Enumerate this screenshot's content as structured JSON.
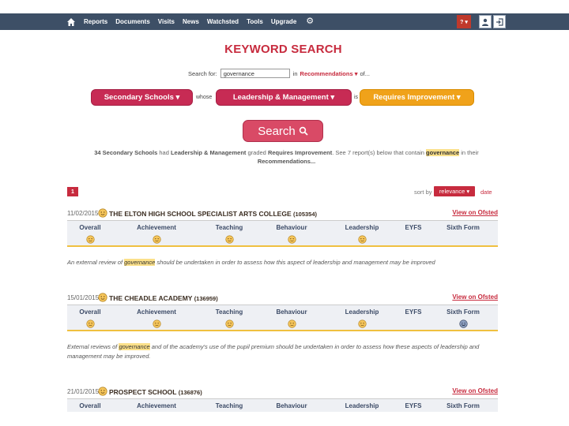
{
  "nav": {
    "items": [
      "Reports",
      "Documents",
      "Visits",
      "News",
      "Watchsted",
      "Tools",
      "Upgrade"
    ],
    "help_label": "? ▾"
  },
  "search": {
    "title": "KEYWORD SEARCH",
    "search_for_label": "Search for:",
    "keyword_value": "governance",
    "in_label": "in",
    "section_label": "Recommendations",
    "section_caret": "▾",
    "of_label": "of...",
    "school_type": "Secondary Schools ▾",
    "whose_label": "whose",
    "judgement": "Leadership & Management ▾",
    "is_label": "is",
    "grade": "Requires Improvement ▾",
    "button_label": "Search"
  },
  "summary": {
    "count_text": "34 Secondary Schools",
    "had_text": " had ",
    "judgement_text": "Leadership & Management",
    "graded_text": " graded ",
    "grade_text": "Requires Improvement",
    "see_text": ". See 7 report(s) below that contain ",
    "keyword_text": "governance",
    "in_their_text": " in their ",
    "section_text": "Recommendations...",
    "page_number": "1",
    "sort_label": "sort by",
    "sort_value": "relevance ▾",
    "sort_alt": "date"
  },
  "grade_headers": [
    "Overall",
    "Achievement",
    "Teaching",
    "Behaviour",
    "Leadership",
    "EYFS",
    "Sixth Form"
  ],
  "results": [
    {
      "date": "11/02/2015",
      "name": "THE ELTON HIGH SCHOOL SPECIALIST ARTS COLLEGE",
      "urn": "(105354)",
      "link": "View on Ofsted",
      "text_before": "An external review of ",
      "keyword": "governance",
      "text_after": " should be undertaken in order to assess how this aspect of leadership and management may be improved"
    },
    {
      "date": "15/01/2015",
      "name": "THE CHEADLE ACADEMY",
      "urn": "(136959)",
      "link": "View on Ofsted",
      "text_before": "External reviews of ",
      "keyword": "governance",
      "text_after": " and of the academy's use of the pupil premium should be undertaken in order to assess how these aspects of leadership and management may be improved."
    },
    {
      "date": "21/01/2015",
      "name": "PROSPECT SCHOOL",
      "urn": "(136876)",
      "link": "View on Ofsted"
    }
  ],
  "colors": {
    "navbar": "#3d4f66",
    "accent_red": "#c72b3e",
    "pill_pink": "#c72b54",
    "pill_orange": "#f0a21a",
    "highlight": "#fbe08a"
  }
}
